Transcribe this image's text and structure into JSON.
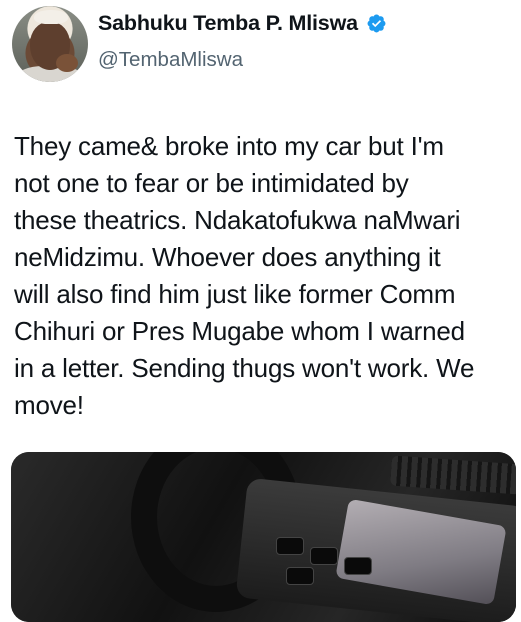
{
  "author": {
    "display_name": "Sabhuku Temba P. Mliswa",
    "handle": "@TembaMliswa",
    "verified": true
  },
  "tweet": {
    "lines": [
      "They came& broke into my car but I'm",
      "not one to fear or be intimidated by",
      "these theatrics. Ndakatofukwa naMwari",
      "neMidzimu. Whoever does anything it",
      "will also find him just like former Comm",
      "Chihuri or Pres Mugabe whom I warned",
      "in a letter. Sending thugs won't work. We",
      "move!"
    ]
  },
  "colors": {
    "text": "#0f1419",
    "secondary": "#536471",
    "verified_badge": "#1d9bf0"
  },
  "icons": {
    "verified": "verified-badge-icon"
  }
}
